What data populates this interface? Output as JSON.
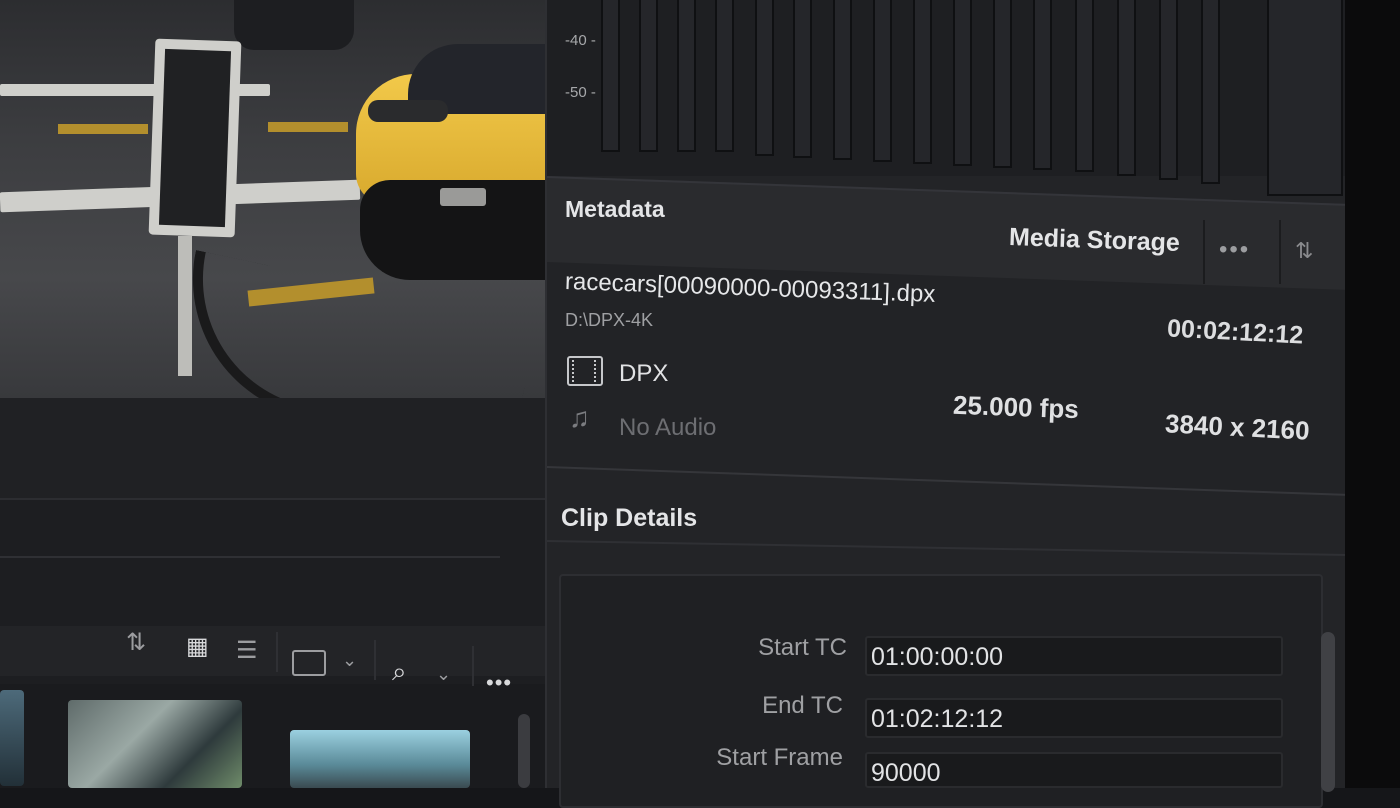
{
  "meters": {
    "scale": [
      "-40 -",
      "-50 -"
    ]
  },
  "metadata": {
    "title": "Metadata",
    "storage_label": "Media Storage",
    "more_icon": "more-horizontal-icon",
    "sort_icon": "sort-icon",
    "file_name": "racecars[00090000-00093311].dpx",
    "path": "D:\\DPX-4K",
    "duration": "00:02:12:12",
    "codec": "DPX",
    "audio": "No Audio",
    "fps": "25.000 fps",
    "resolution": "3840 x 2160"
  },
  "clip_details": {
    "title": "Clip Details",
    "rows": [
      {
        "label": "Start TC",
        "value": "01:00:00:00"
      },
      {
        "label": "End TC",
        "value": "01:02:12:12"
      },
      {
        "label": "Start Frame",
        "value": "90000"
      }
    ]
  },
  "media_pool": {
    "transport": {
      "next": "⏭",
      "prev": "⏮"
    },
    "toolbar_icons": [
      "sort-icon",
      "thumbnail-view-icon",
      "list-view-icon",
      "clip-view-icon",
      "search-icon",
      "more-horizontal-icon"
    ]
  }
}
